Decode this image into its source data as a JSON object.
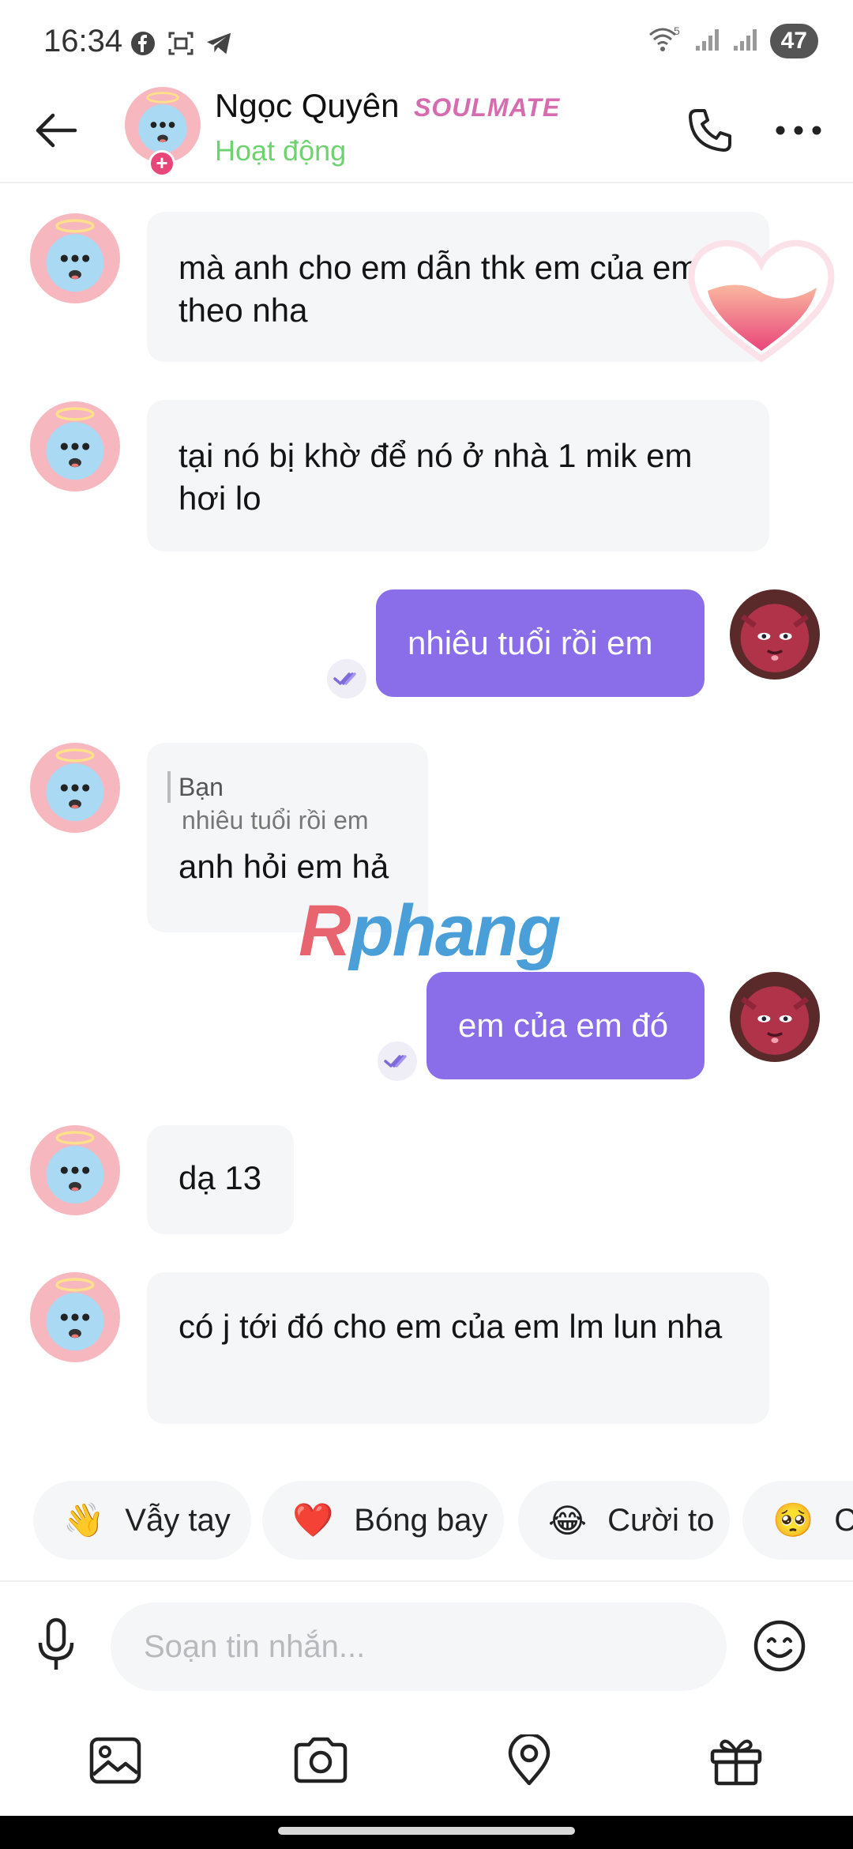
{
  "status_bar": {
    "time": "16:34",
    "app_icons": [
      "facebook-icon",
      "screenshot-icon",
      "telegram-icon"
    ],
    "battery": "47",
    "wifi_label": "5"
  },
  "header": {
    "name": "Ngọc Quyên",
    "badge": "SOULMATE",
    "status": "Hoạt động",
    "status_color": "#6ed36e"
  },
  "messages": [
    {
      "side": "in",
      "text": "mà anh cho em dẫn thk em của em theo nha"
    },
    {
      "side": "in",
      "text": "tại nó bị khờ để nó ở nhà 1 mik em hơi lo"
    },
    {
      "side": "out",
      "text": "nhiêu tuổi rồi em"
    },
    {
      "side": "in",
      "quote_author": "Bạn",
      "quote_text": "nhiêu tuổi rồi em",
      "text": "anh hỏi em hả"
    },
    {
      "side": "out",
      "text": "em của em đó"
    },
    {
      "side": "in",
      "text": "dạ 13"
    },
    {
      "side": "in",
      "text": "có j tới đó cho em của em lm lun nha"
    }
  ],
  "watermark": {
    "first": "R",
    "rest": "phang"
  },
  "quick_reactions": [
    {
      "emoji": "👋",
      "label": "Vẫy tay"
    },
    {
      "emoji": "❤️",
      "label": "Bóng bay"
    },
    {
      "emoji": "😂",
      "label": "Cười to"
    },
    {
      "emoji": "🥺",
      "label": "Cả"
    }
  ],
  "composer": {
    "placeholder": "Soạn tin nhắn..."
  },
  "colors": {
    "outgoing_bubble": "#8a6de9",
    "incoming_bubble": "#f5f6f8",
    "accent_pink": "#d76bb0"
  }
}
